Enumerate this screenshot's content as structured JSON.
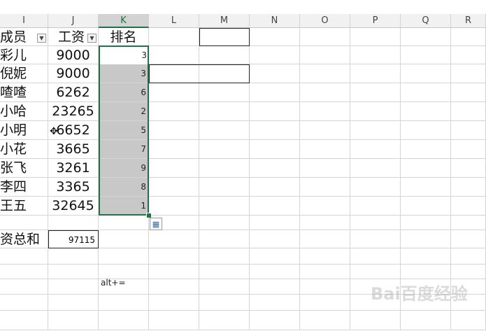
{
  "columns": [
    "I",
    "J",
    "K",
    "L",
    "M",
    "N",
    "O",
    "P",
    "Q",
    "R"
  ],
  "selected_column": "K",
  "headers": {
    "member": "成员",
    "salary": "工资",
    "rank": "排名"
  },
  "rows": [
    {
      "name": "彩儿",
      "salary": "9000",
      "rank": "3"
    },
    {
      "name": "倪妮",
      "salary": "9000",
      "rank": "3"
    },
    {
      "name": "喳喳",
      "salary": "6262",
      "rank": "6"
    },
    {
      "name": "小哈",
      "salary": "23265",
      "rank": "2"
    },
    {
      "name": "小明",
      "salary": "6652",
      "rank": "5"
    },
    {
      "name": "小花",
      "salary": "3665",
      "rank": "7"
    },
    {
      "name": "张飞",
      "salary": "3261",
      "rank": "9"
    },
    {
      "name": "李四",
      "salary": "3365",
      "rank": "8"
    },
    {
      "name": "王五",
      "salary": "32645",
      "rank": "1"
    }
  ],
  "total": {
    "label": "资总和",
    "value": "97115"
  },
  "note": "alt+=",
  "watermark": "Bai百度经验",
  "icons": {
    "filter_dropdown": "dropdown-arrow-icon",
    "quick_analysis": "quick-analysis-icon",
    "cursor": "cross-cursor-icon"
  },
  "colors": {
    "selection_border": "#217346",
    "selection_fill": "#c8c8c8"
  }
}
